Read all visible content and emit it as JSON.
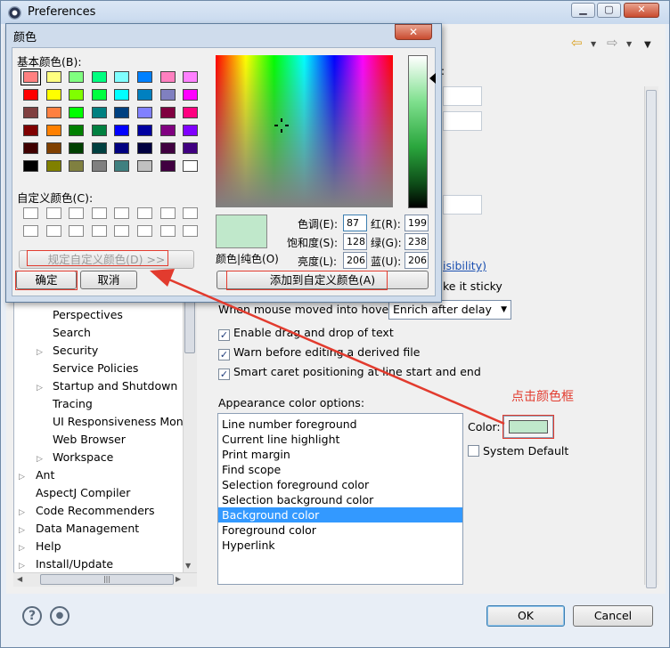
{
  "window": {
    "title": "Preferences"
  },
  "tree": {
    "items": [
      {
        "label": "Perspectives",
        "indent": 2,
        "expander": false
      },
      {
        "label": "Search",
        "indent": 2,
        "expander": false
      },
      {
        "label": "Security",
        "indent": 2,
        "expander": true
      },
      {
        "label": "Service Policies",
        "indent": 2,
        "expander": false
      },
      {
        "label": "Startup and Shutdown",
        "indent": 2,
        "expander": true
      },
      {
        "label": "Tracing",
        "indent": 2,
        "expander": false
      },
      {
        "label": "UI Responsiveness Monit",
        "indent": 2,
        "expander": false
      },
      {
        "label": "Web Browser",
        "indent": 2,
        "expander": false
      },
      {
        "label": "Workspace",
        "indent": 2,
        "expander": true
      },
      {
        "label": "Ant",
        "indent": 1,
        "expander": true
      },
      {
        "label": "AspectJ Compiler",
        "indent": 1,
        "expander": false
      },
      {
        "label": "Code Recommenders",
        "indent": 1,
        "expander": true
      },
      {
        "label": "Data Management",
        "indent": 1,
        "expander": true
      },
      {
        "label": "Help",
        "indent": 1,
        "expander": true
      },
      {
        "label": "Install/Update",
        "indent": 1,
        "expander": true
      }
    ]
  },
  "content": {
    "partial_link": "isibility)",
    "partial_sticky": "ke it sticky",
    "hover_label": "When mouse moved into hover:",
    "hover_value": "Enrich after delay",
    "checkboxes": [
      {
        "label": "Enable drag and drop of text",
        "checked": true
      },
      {
        "label": "Warn before editing a derived file",
        "checked": true
      },
      {
        "label": "Smart caret positioning at line start and end",
        "checked": true
      }
    ],
    "appearance_label": "Appearance color options:",
    "color_options": [
      "Line number foreground",
      "Current line highlight",
      "Print margin",
      "Find scope",
      "Selection foreground color",
      "Selection background color",
      "Background color",
      "Foreground color",
      "Hyperlink"
    ],
    "selected_option_index": 6,
    "color_label": "Color:",
    "system_default_label": "System Default",
    "system_default_checked": false,
    "current_color": "#c0e8cb"
  },
  "annotation": {
    "text": "点击颜色框",
    "color": "#e23b2e"
  },
  "buttons": {
    "ok": "OK",
    "cancel": "Cancel"
  },
  "color_dialog": {
    "title": "颜色",
    "close_symbol": "✕",
    "basic_colors_label": "基本颜色(B):",
    "custom_colors_label": "自定义颜色(C):",
    "define_custom_button": "规定自定义颜色(D) >>",
    "ok_button": "确定",
    "cancel_button": "取消",
    "add_custom_button": "添加到自定义颜色(A)",
    "solid_label": "颜色|纯色(O)",
    "hue_label": "色调(E):",
    "sat_label": "饱和度(S):",
    "lum_label": "亮度(L):",
    "red_label": "红(R):",
    "green_label": "绿(G):",
    "blue_label": "蓝(U):",
    "hue": "87",
    "sat": "128",
    "lum": "206",
    "red": "199",
    "green": "238",
    "blue": "206",
    "basic_colors": [
      "#ff8080",
      "#ffff80",
      "#80ff80",
      "#00ff80",
      "#80ffff",
      "#0080ff",
      "#ff80c0",
      "#ff80ff",
      "#ff0000",
      "#ffff00",
      "#80ff00",
      "#00ff40",
      "#00ffff",
      "#0080c0",
      "#8080c0",
      "#ff00ff",
      "#804040",
      "#ff8040",
      "#00ff00",
      "#008080",
      "#004080",
      "#8080ff",
      "#800040",
      "#ff0080",
      "#800000",
      "#ff8000",
      "#008000",
      "#008040",
      "#0000ff",
      "#0000a0",
      "#800080",
      "#8000ff",
      "#400000",
      "#804000",
      "#004000",
      "#004040",
      "#000080",
      "#000040",
      "#400040",
      "#400080",
      "#000000",
      "#808000",
      "#808040",
      "#808080",
      "#408080",
      "#c0c0c0",
      "#400040",
      "#ffffff"
    ]
  }
}
